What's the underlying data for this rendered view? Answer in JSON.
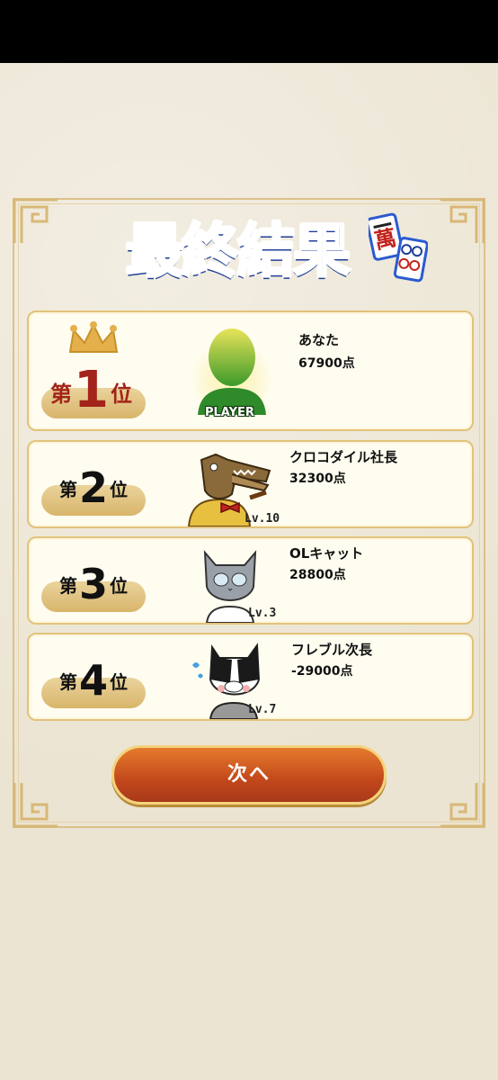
{
  "title": "最終結果",
  "results": [
    {
      "rank_prefix": "第",
      "rank_num": "1",
      "rank_suffix": "位",
      "name": "あなた",
      "score": "67900点",
      "avatar_label": "PLAYER",
      "level": ""
    },
    {
      "rank_prefix": "第",
      "rank_num": "2",
      "rank_suffix": "位",
      "name": "クロコダイル社長",
      "score": "32300点",
      "level": "Lv.10"
    },
    {
      "rank_prefix": "第",
      "rank_num": "3",
      "rank_suffix": "位",
      "name": "OLキャット",
      "score": "28800点",
      "level": "Lv.3"
    },
    {
      "rank_prefix": "第",
      "rank_num": "4",
      "rank_suffix": "位",
      "name": "フレブル次長",
      "score": "-29000点",
      "level": "Lv.7"
    }
  ],
  "next_button": "次へ",
  "tile_char": "萬"
}
